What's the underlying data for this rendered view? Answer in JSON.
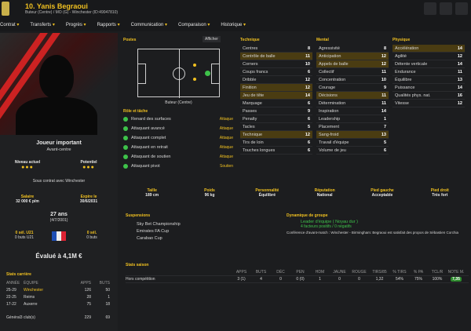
{
  "header": {
    "name": "10. Yanis Begraoui",
    "subtitle": "Buteur (Centre) / MO (G) - Winchester (ID:49047810)"
  },
  "nav": [
    "Contrat",
    "Transferts",
    "Progrès",
    "Rapports",
    "Communication",
    "Comparaison",
    "Historique"
  ],
  "profile": {
    "role": "Joueur important",
    "position": "Avant-centre",
    "current_label": "Niveau actuel",
    "potential_label": "Potentiel",
    "contract_text": "Sous contrat avec Winchester",
    "salary_label": "Salaire",
    "salary": "32 000 € p/m",
    "expiry_label": "Expire le",
    "expiry": "30/6/2031",
    "age": "27 ans",
    "dob": "(4/7/2001)",
    "u21_left_label": "0 sél. U21",
    "u21_left_sub": "0 buts U21",
    "u21_right_label": "0 sél.",
    "u21_right_sub": "0 buts",
    "value": "Évalué à 4,1M €"
  },
  "career": {
    "title": "Stats carrière",
    "headers": [
      "ANNÉE",
      "ÉQUIPE",
      "APPS",
      "BUTS"
    ],
    "rows": [
      {
        "year": "25-29",
        "team": "Winchester",
        "apps": "126",
        "goals": "50"
      },
      {
        "year": "22-25",
        "team": "Reims",
        "apps": "28",
        "goals": "1"
      },
      {
        "year": "17-22",
        "team": "Auxerre",
        "apps": "75",
        "goals": "18"
      }
    ],
    "total_label": "Général3 club(s)",
    "total_apps": "229",
    "total_goals": "69"
  },
  "postes": {
    "title": "Postes",
    "show_label": "Afficher",
    "role_name": "Buteur (Centre)"
  },
  "roles": {
    "title": "Rôle et tâche",
    "items": [
      {
        "name": "Renard des surfaces",
        "tag": "Attaque"
      },
      {
        "name": "Attaquant avancé",
        "tag": "Attaque"
      },
      {
        "name": "Attaquant complet",
        "tag": "Attaque"
      },
      {
        "name": "Attaquant en retrait",
        "tag": "Attaque"
      },
      {
        "name": "Attaquant de soutien",
        "tag": "Attaque"
      },
      {
        "name": "Attaquant pivot",
        "tag": "Soutien"
      }
    ]
  },
  "technique": {
    "title": "Technique",
    "rows": [
      {
        "k": "Centres",
        "v": "8"
      },
      {
        "k": "Contrôle de balle",
        "v": "11",
        "hl": true
      },
      {
        "k": "Corners",
        "v": "10"
      },
      {
        "k": "Coups francs",
        "v": "6"
      },
      {
        "k": "Dribble",
        "v": "12"
      },
      {
        "k": "Finition",
        "v": "12",
        "hl": true
      },
      {
        "k": "Jeu de tête",
        "v": "14",
        "hl": true
      },
      {
        "k": "Marquage",
        "v": "6"
      },
      {
        "k": "Passes",
        "v": "9"
      },
      {
        "k": "Penalty",
        "v": "6"
      },
      {
        "k": "Tacles",
        "v": "5"
      },
      {
        "k": "Technique",
        "v": "12",
        "hl": true
      },
      {
        "k": "Tirs de loin",
        "v": "6"
      },
      {
        "k": "Touches longues",
        "v": "6"
      }
    ]
  },
  "mental": {
    "title": "Mental",
    "rows": [
      {
        "k": "Agressivité",
        "v": "8"
      },
      {
        "k": "Anticipation",
        "v": "12",
        "hl": true
      },
      {
        "k": "Appels de balle",
        "v": "12",
        "hl": true
      },
      {
        "k": "Collectif",
        "v": "11"
      },
      {
        "k": "Concentration",
        "v": "10"
      },
      {
        "k": "Courage",
        "v": "9"
      },
      {
        "k": "Décisions",
        "v": "11",
        "hl": true
      },
      {
        "k": "Détermination",
        "v": "11"
      },
      {
        "k": "Inspiration",
        "v": "14"
      },
      {
        "k": "Leadership",
        "v": "1"
      },
      {
        "k": "Placement",
        "v": "7"
      },
      {
        "k": "Sang-froid",
        "v": "13",
        "hl": true
      },
      {
        "k": "Travail d'équipe",
        "v": "5"
      },
      {
        "k": "Volume de jeu",
        "v": "6"
      }
    ]
  },
  "physique": {
    "title": "Physique",
    "rows": [
      {
        "k": "Accélération",
        "v": "14",
        "hl": true
      },
      {
        "k": "Agilité",
        "v": "12"
      },
      {
        "k": "Détente verticale",
        "v": "14"
      },
      {
        "k": "Endurance",
        "v": "11"
      },
      {
        "k": "Équilibre",
        "v": "13"
      },
      {
        "k": "Puissance",
        "v": "14"
      },
      {
        "k": "Qualités phys. nat.",
        "v": "16"
      },
      {
        "k": "Vitesse",
        "v": "12"
      }
    ]
  },
  "info": [
    {
      "label": "Taille",
      "value": "189 cm"
    },
    {
      "label": "Poids",
      "value": "96 kg"
    },
    {
      "label": "Personnalité",
      "value": "Équilibré"
    },
    {
      "label": "Réputation",
      "value": "National"
    },
    {
      "label": "Pied gauche",
      "value": "Acceptable"
    },
    {
      "label": "Pied droit",
      "value": "Très fort"
    }
  ],
  "suspensions": {
    "title": "Suspensions",
    "items": [
      "Sky Bet Championship",
      "Emirates FA Cup",
      "Carabao Cup"
    ]
  },
  "dynamics": {
    "title": "Dynamique de groupe",
    "leader": "Leader d'équipe ( Noyau dur )",
    "factors": "4 facteurs positifs / 0 négatifs",
    "text": "Conférence d'avant-match : Winchester - Birmingham: Begraoui est satisfait des propos de Sébastien Corchia"
  },
  "stats": {
    "title": "Stats saison",
    "headers": [
      "APPS",
      "BUTS",
      "DÉC",
      "PEN",
      "HDM",
      "JAUNE",
      "ROUGE",
      "TIRS/85",
      "% TIRS",
      "% PA",
      "TCL/R",
      "NOTE M."
    ],
    "row_label": "Hors compétition",
    "row": [
      "3 (1)",
      "4",
      "0",
      "0 (0)",
      "1",
      "0",
      "0",
      "1,32",
      "54%",
      "75%",
      "100%",
      "7,35"
    ]
  }
}
